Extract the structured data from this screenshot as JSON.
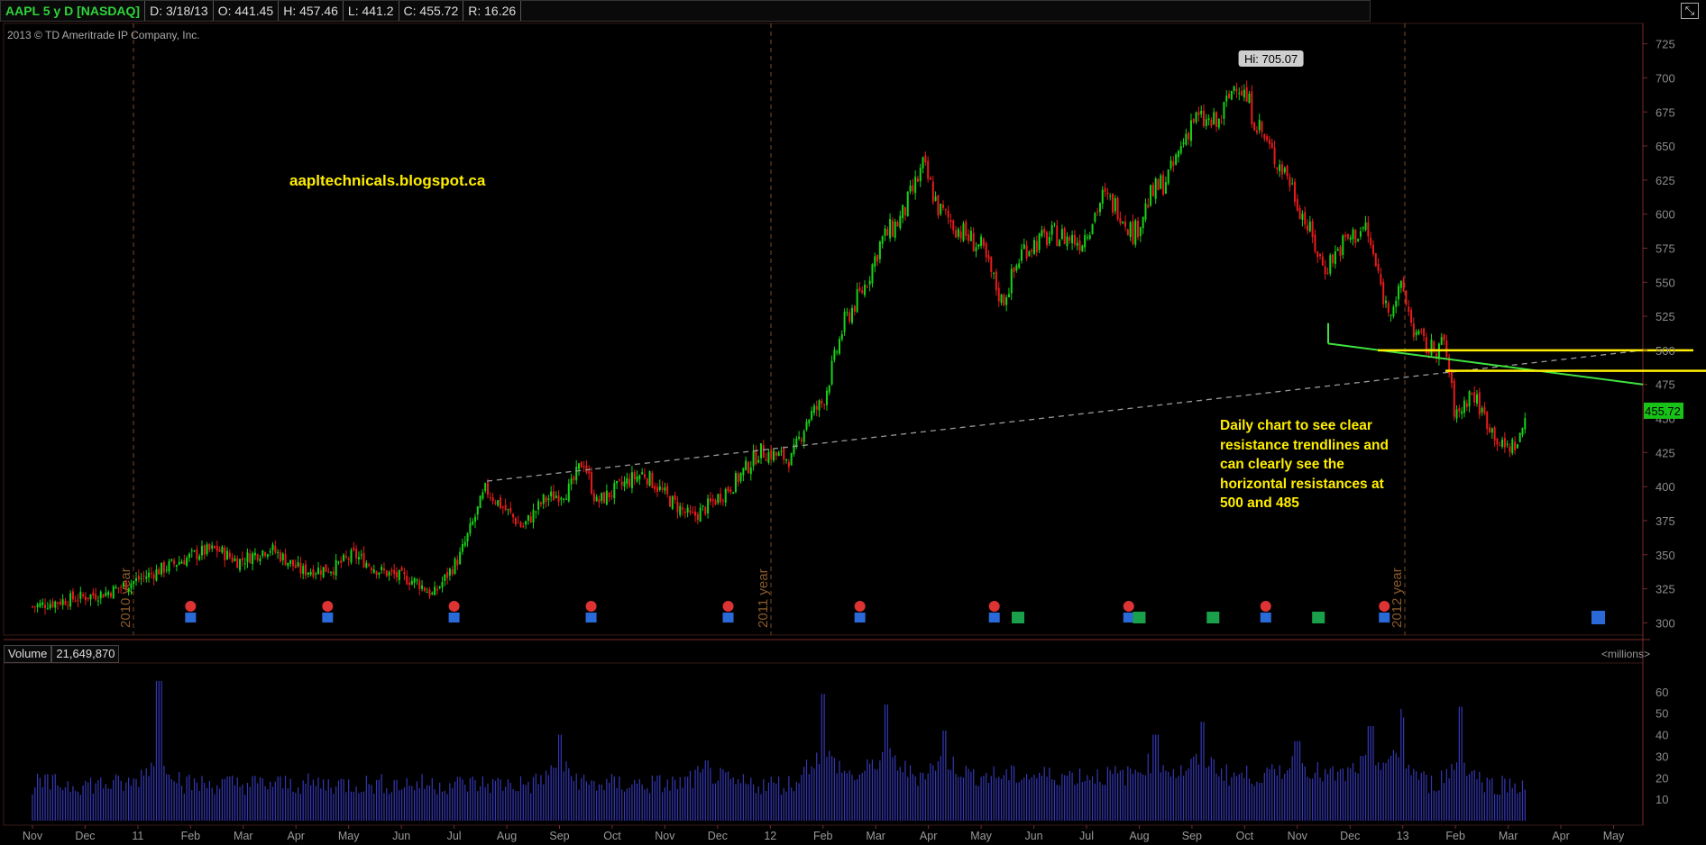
{
  "header": {
    "symbol": "AAPL 5 y D [NASDAQ]",
    "date": "D: 3/18/13",
    "open": "O: 441.45",
    "high": "H: 457.46",
    "low": "L: 441.2",
    "close": "C: 455.72",
    "range": "R: 16.26"
  },
  "copyright": "2013 © TD Ameritrade IP Company, Inc.",
  "watermark": "aapltechnicals.blogspot.ca",
  "annotation": "Daily chart to see clear resistance trendlines and can clearly see the horizontal resistances at 500 and 485",
  "annotation_lines": [
    "Daily chart to see clear",
    "resistance trendlines and",
    "can clearly see the",
    "horizontal resistances at",
    "500 and 485"
  ],
  "volume_panel": {
    "label": "Volume",
    "value": "21,649,870",
    "units": "<millions>"
  },
  "colors": {
    "up": "#17d317",
    "down": "#e81b1b",
    "volume": "#3538b8",
    "resistance": "#ffee00",
    "trendline": "#3fe13f",
    "background": "#000000",
    "axis": "#7a2a2a",
    "price_tag": "#19c219"
  },
  "chart_data": [
    {
      "type": "candlestick",
      "title": "AAPL 5 y D [NASDAQ]",
      "x": [
        "Nov",
        "Dec",
        "11",
        "Feb",
        "Mar",
        "Apr",
        "May",
        "Jun",
        "Jul",
        "Aug",
        "Sep",
        "Oct",
        "Nov",
        "Dec",
        "12",
        "Feb",
        "Mar",
        "Apr",
        "May",
        "Jun",
        "Jul",
        "Aug",
        "Sep",
        "Oct",
        "Nov",
        "Dec",
        "13",
        "Feb",
        "Mar",
        "Apr",
        "May"
      ],
      "y_ticks": [
        300,
        325,
        350,
        375,
        400,
        425,
        450,
        475,
        500,
        525,
        550,
        575,
        600,
        625,
        650,
        675,
        700,
        725
      ],
      "ylim": [
        291,
        736
      ],
      "year_markers": [
        "2010 year",
        "2011 year",
        "2012 year"
      ],
      "last_price": "455.72",
      "high_label": "Hi: 705.07",
      "series": [
        {
          "t": 0.0,
          "v": 312
        },
        {
          "t": 0.8,
          "v": 318
        },
        {
          "t": 1.4,
          "v": 322
        },
        {
          "t": 1.9,
          "v": 330
        },
        {
          "t": 2.6,
          "v": 342
        },
        {
          "t": 3.2,
          "v": 352
        },
        {
          "t": 3.5,
          "v": 354
        },
        {
          "t": 3.9,
          "v": 345
        },
        {
          "t": 4.5,
          "v": 355
        },
        {
          "t": 5.1,
          "v": 338
        },
        {
          "t": 5.7,
          "v": 340
        },
        {
          "t": 6.1,
          "v": 350
        },
        {
          "t": 6.6,
          "v": 338
        },
        {
          "t": 7.3,
          "v": 330
        },
        {
          "t": 7.6,
          "v": 320
        },
        {
          "t": 8.1,
          "v": 348
        },
        {
          "t": 8.6,
          "v": 398
        },
        {
          "t": 9.0,
          "v": 382
        },
        {
          "t": 9.3,
          "v": 370
        },
        {
          "t": 9.7,
          "v": 390
        },
        {
          "t": 10.2,
          "v": 398
        },
        {
          "t": 10.45,
          "v": 420
        },
        {
          "t": 10.7,
          "v": 388
        },
        {
          "t": 11.3,
          "v": 404
        },
        {
          "t": 11.6,
          "v": 410
        },
        {
          "t": 12.1,
          "v": 390
        },
        {
          "t": 12.5,
          "v": 377
        },
        {
          "t": 12.8,
          "v": 385
        },
        {
          "t": 13.3,
          "v": 402
        },
        {
          "t": 13.8,
          "v": 426
        },
        {
          "t": 14.4,
          "v": 420
        },
        {
          "t": 14.7,
          "v": 450
        },
        {
          "t": 15.0,
          "v": 462
        },
        {
          "t": 15.4,
          "v": 520
        },
        {
          "t": 15.8,
          "v": 548
        },
        {
          "t": 16.1,
          "v": 580
        },
        {
          "t": 16.5,
          "v": 598
        },
        {
          "t": 16.9,
          "v": 635
        },
        {
          "t": 17.2,
          "v": 603
        },
        {
          "t": 17.6,
          "v": 588
        },
        {
          "t": 18.0,
          "v": 575
        },
        {
          "t": 18.4,
          "v": 535
        },
        {
          "t": 18.8,
          "v": 575
        },
        {
          "t": 19.4,
          "v": 585
        },
        {
          "t": 19.9,
          "v": 580
        },
        {
          "t": 20.3,
          "v": 612
        },
        {
          "t": 20.6,
          "v": 605
        },
        {
          "t": 20.9,
          "v": 585
        },
        {
          "t": 21.2,
          "v": 612
        },
        {
          "t": 21.6,
          "v": 630
        },
        {
          "t": 22.0,
          "v": 670
        },
        {
          "t": 22.5,
          "v": 665
        },
        {
          "t": 22.85,
          "v": 700
        },
        {
          "t": 23.2,
          "v": 670
        },
        {
          "t": 23.5,
          "v": 645
        },
        {
          "t": 23.8,
          "v": 630
        },
        {
          "t": 24.1,
          "v": 600
        },
        {
          "t": 24.5,
          "v": 560
        },
        {
          "t": 24.9,
          "v": 580
        },
        {
          "t": 25.3,
          "v": 590
        },
        {
          "t": 25.7,
          "v": 530
        },
        {
          "t": 26.0,
          "v": 545
        },
        {
          "t": 26.2,
          "v": 515
        },
        {
          "t": 26.5,
          "v": 500
        },
        {
          "t": 26.8,
          "v": 505
        },
        {
          "t": 27.0,
          "v": 450
        },
        {
          "t": 27.3,
          "v": 470
        },
        {
          "t": 27.6,
          "v": 448
        },
        {
          "t": 27.9,
          "v": 428
        },
        {
          "t": 28.2,
          "v": 432
        },
        {
          "t": 28.35,
          "v": 455
        }
      ]
    },
    {
      "type": "bar",
      "title": "Volume",
      "y_ticks": [
        10,
        20,
        30,
        40,
        50,
        60
      ],
      "ylim": [
        0,
        70
      ],
      "x_ticks": [
        "Nov",
        "Dec",
        "11",
        "Feb",
        "Mar",
        "Apr",
        "May",
        "Jun",
        "Jul",
        "Aug",
        "Sep",
        "Oct",
        "Nov",
        "Dec",
        "12",
        "Feb",
        "Mar",
        "Apr",
        "May",
        "Jun",
        "Jul",
        "Aug",
        "Sep",
        "Oct",
        "Nov",
        "Dec",
        "13",
        "Feb",
        "Mar",
        "Apr",
        "May"
      ],
      "spikes": [
        {
          "t": 2.4,
          "v": 65
        },
        {
          "t": 10.0,
          "v": 40
        },
        {
          "t": 12.8,
          "v": 28
        },
        {
          "t": 15.0,
          "v": 55
        },
        {
          "t": 16.2,
          "v": 50
        },
        {
          "t": 17.3,
          "v": 38
        },
        {
          "t": 21.3,
          "v": 36
        },
        {
          "t": 22.2,
          "v": 42
        },
        {
          "t": 24.0,
          "v": 33
        },
        {
          "t": 25.4,
          "v": 40
        },
        {
          "t": 26.0,
          "v": 48
        },
        {
          "t": 27.1,
          "v": 53
        }
      ]
    }
  ],
  "resistance_levels": [
    500,
    485
  ]
}
